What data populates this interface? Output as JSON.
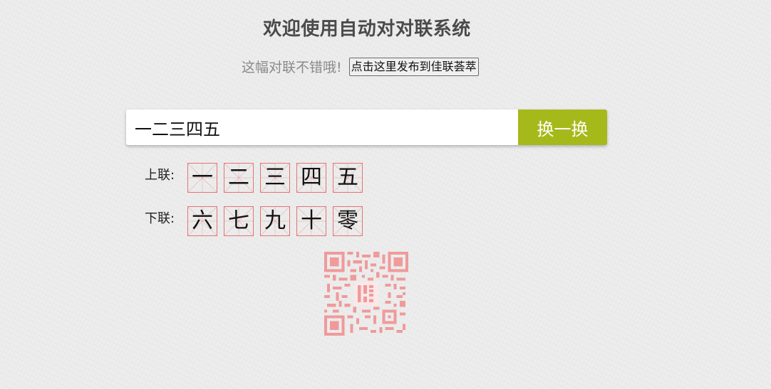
{
  "header": {
    "title": "欢迎使用自动对对联系统"
  },
  "feedback": {
    "message": "这幅对联不错哦!",
    "publish_button": "点击这里发布到佳联荟萃"
  },
  "input": {
    "value": "一二三四五",
    "swap_button": "换一换"
  },
  "couplet": {
    "upper_label": "上联:",
    "lower_label": "下联:",
    "upper": [
      "一",
      "二",
      "三",
      "四",
      "五"
    ],
    "lower": [
      "六",
      "七",
      "九",
      "十",
      "零"
    ]
  },
  "qr": {
    "icon": "qr-code-icon",
    "color": "#f09a9a"
  },
  "colors": {
    "accent": "#a6b91a",
    "grid": "#e57373"
  }
}
